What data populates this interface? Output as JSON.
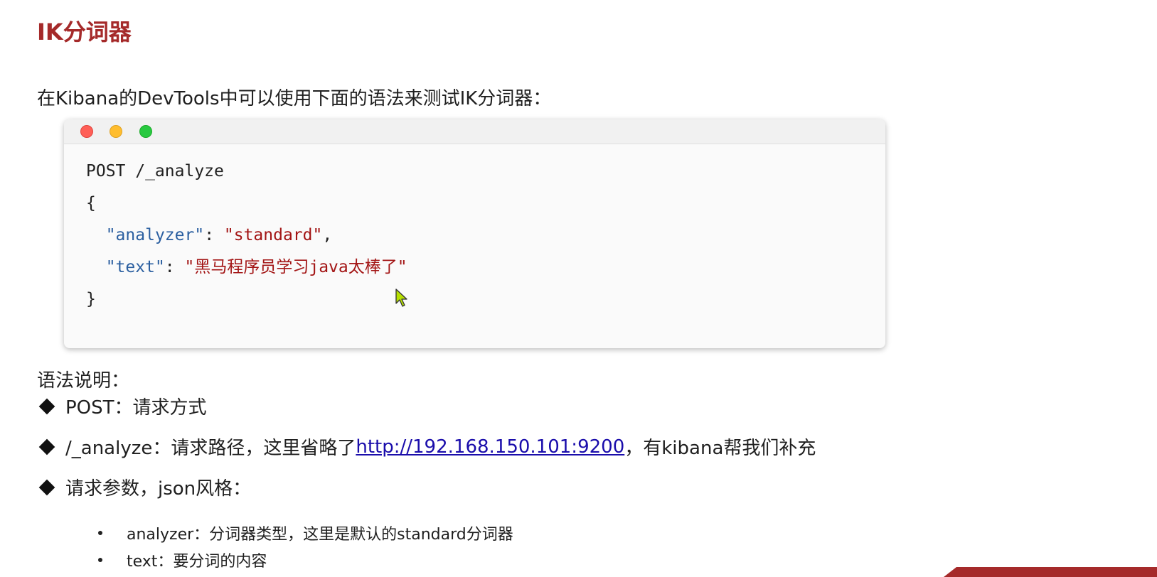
{
  "title": "IK分词器",
  "intro": "在Kibana的DevTools中可以使用下面的语法来测试IK分词器：",
  "code": {
    "line1": "POST /_analyze",
    "line2": "{",
    "line3_key": "\"analyzer\"",
    "line3_sep": ": ",
    "line3_val": "\"standard\"",
    "line3_end": ",",
    "line4_key": "\"text\"",
    "line4_sep": ": ",
    "line4_val": "\"黑马程序员学习java太棒了\"",
    "line5": "}"
  },
  "explain_heading": "语法说明：",
  "bullets": {
    "b1": "POST：请求方式",
    "b2_prefix": "/_analyze：请求路径，这里省略了",
    "b2_link": "http://192.168.150.101:9200",
    "b2_suffix": "，有kibana帮我们补充",
    "b3": "请求参数，json风格："
  },
  "sub_bullets": {
    "s1": "analyzer：分词器类型，这里是默认的standard分词器",
    "s2": "text：要分词的内容"
  },
  "colors": {
    "title": "#a52a2a",
    "json_key": "#2b5fa0",
    "json_string": "#a31515",
    "link": "#1a0dab"
  }
}
